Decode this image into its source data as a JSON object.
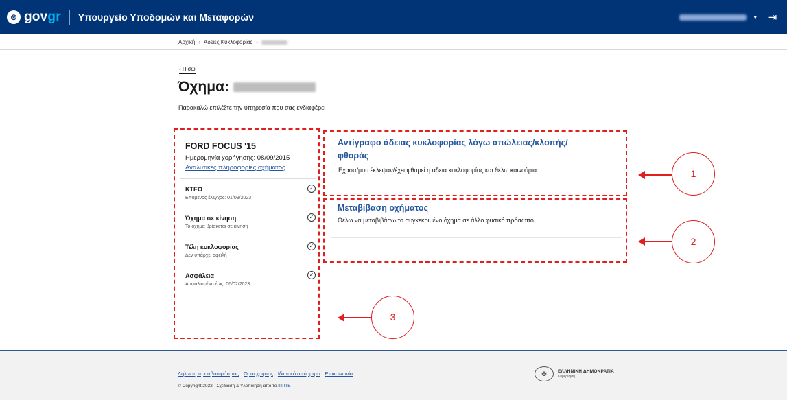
{
  "header": {
    "logo_text_a": "gov",
    "logo_text_b": "gr",
    "ministry": "Υπουργείο Υποδομών και Μεταφορών",
    "user_caret": "▾",
    "logout_icon": "logout-icon"
  },
  "breadcrumb": {
    "home": "Αρχική",
    "sep": "›",
    "licences": "Άδειες Κυκλοφορίας"
  },
  "back_link": "‹ Πίσω",
  "page_title": "Όχημα:",
  "subtitle": "Παρακαλώ επιλέξτε την υπηρεσία που σας ενδιαφέρει",
  "vehicle": {
    "model": "FORD FOCUS '15",
    "grant_date": "Ημερομηνία χορήγησης: 08/09/2015",
    "details_link": "Αναλυτικές πληροφορίες οχήματος",
    "statuses": [
      {
        "title": "ΚΤΕΟ",
        "subtitle": "Επόμενος έλεγχος: 01/09/2023"
      },
      {
        "title": "Όχημα σε κίνηση",
        "subtitle": "Το όχημα βρίσκεται σε κίνηση"
      },
      {
        "title": "Τέλη κυκλοφορίας",
        "subtitle": "Δεν υπάρχει οφειλή"
      },
      {
        "title": "Ασφάλεια",
        "subtitle": "Ασφαλισμένο έως: 06/02/2023"
      }
    ]
  },
  "services": [
    {
      "title_line1": "Αντίγραφο άδειας κυκλοφορίας λόγω απώλειας/κλοπής/",
      "title_line2": "φθοράς",
      "description": "Έχασα/μου έκλεψαν/έχει φθαρεί η άδεια κυκλοφορίας και θέλω καινούρια."
    },
    {
      "title_line1": "Μεταβίβαση οχήματος",
      "description": "Θέλω να μεταβιβάσω το συγκεκριμένο όχημα σε άλλο φυσικό πρόσωπο."
    }
  ],
  "annotations": {
    "one": "1",
    "two": "2",
    "three": "3"
  },
  "footer": {
    "links": [
      "Δήλωση προσβασιμότητας",
      "Όροι χρήσης",
      "Ιδιωτικό απόρρητο",
      "Επικοινωνία"
    ],
    "copyright_prefix": "© Copyright 2022 - Σχεδίαση & Υλοποίηση από το",
    "copyright_link": "ΙΠ ΙΤΕ",
    "gov_line1": "ΕΛΛΗΝΙΚΗ ΔΗΜΟΚΡΑΤΙΑ",
    "gov_line2": "Κυβέρνηση"
  },
  "colors": {
    "header_bg": "#003476",
    "link": "#2556a0",
    "annotation": "#e01f1f",
    "accent_gr": "#00aeef"
  }
}
